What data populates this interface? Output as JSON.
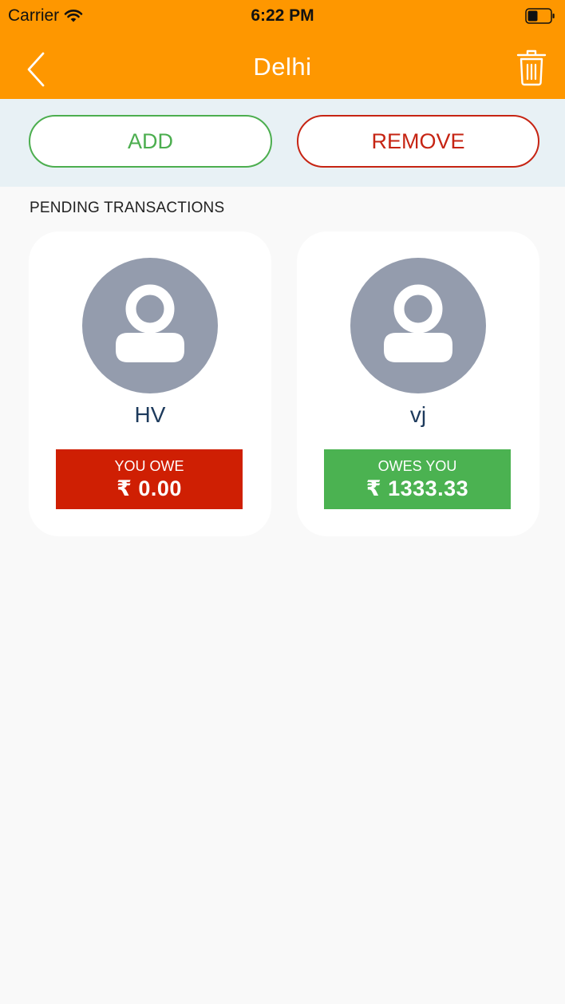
{
  "status_bar": {
    "carrier": "Carrier",
    "time": "6:22 PM"
  },
  "nav": {
    "title": "Delhi"
  },
  "actions": {
    "add_label": "ADD",
    "remove_label": "REMOVE"
  },
  "section": {
    "title": "PENDING TRANSACTIONS"
  },
  "transactions": [
    {
      "name": "HV",
      "status_label": "YOU OWE",
      "amount": "₹ 0.00"
    },
    {
      "name": "vj",
      "status_label": "OWES YOU",
      "amount": "₹ 1333.33"
    }
  ],
  "colors": {
    "header": "#fe9700",
    "action_bar": "#e8f1f5",
    "add": "#4cae4f",
    "remove": "#c62413",
    "you_owe": "#cf1f03",
    "owes_you": "#4bb251",
    "avatar": "#949cad",
    "name_text": "#1d3a5c"
  },
  "icons": {
    "wifi": "wifi-icon",
    "battery": "battery-icon",
    "back": "chevron-left-icon",
    "delete": "trash-icon",
    "avatar": "person-icon"
  }
}
